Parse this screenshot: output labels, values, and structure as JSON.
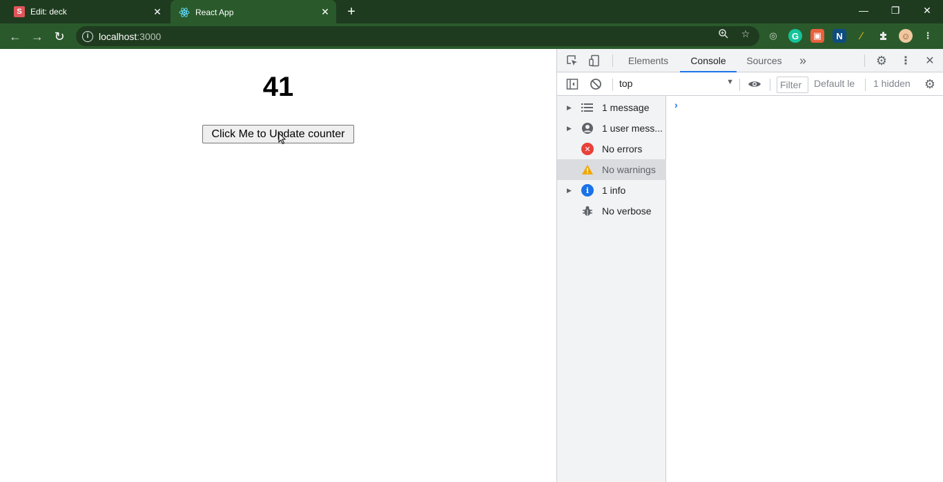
{
  "browser": {
    "tabs": [
      {
        "title": "Edit: deck",
        "favicon": "S",
        "active": false
      },
      {
        "title": "React App",
        "favicon": "react-icon",
        "active": true
      }
    ],
    "new_tab_glyph": "+",
    "url_host": "localhost",
    "url_port": ":3000",
    "colors": {
      "frame": "#1e3b1f",
      "toolbar": "#2a5a2b"
    }
  },
  "page": {
    "counter": "41",
    "button_label": "Click Me to Update counter"
  },
  "devtools": {
    "tabs": [
      "Elements",
      "Console",
      "Sources"
    ],
    "active_tab": "Console",
    "more_tabs_glyph": "»",
    "context": "top",
    "filter_placeholder": "Filter",
    "levels": "Default le",
    "hidden": "1 hidden",
    "sidebar": [
      {
        "label": "1 message",
        "icon": "list-icon",
        "expandable": true
      },
      {
        "label": "1 user mess...",
        "icon": "user-icon",
        "expandable": true
      },
      {
        "label": "No errors",
        "icon": "error-icon",
        "expandable": false
      },
      {
        "label": "No warnings",
        "icon": "warning-icon",
        "expandable": false,
        "selected": true
      },
      {
        "label": "1 info",
        "icon": "info-icon",
        "expandable": true
      },
      {
        "label": "No verbose",
        "icon": "bug-icon",
        "expandable": false
      }
    ],
    "prompt": "›",
    "accent": "#1a73e8"
  }
}
